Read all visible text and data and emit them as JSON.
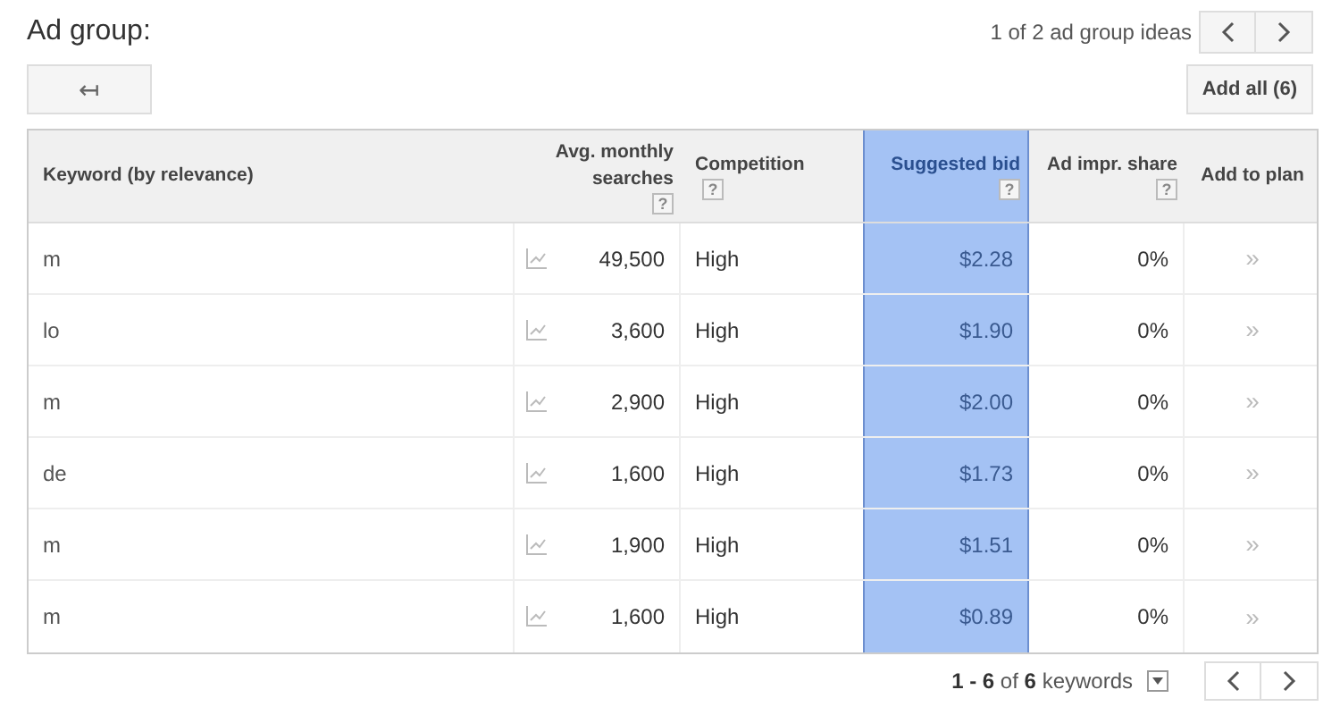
{
  "title": "Ad group:",
  "pager": {
    "text": "1 of 2 ad group ideas"
  },
  "back_button": "↤",
  "add_all_button": "Add all (6)",
  "columns": [
    {
      "label": "Keyword (by relevance)",
      "highlighted": false
    },
    {
      "label": "Avg. monthly searches",
      "help": "?",
      "highlighted": false
    },
    {
      "label": "Competition",
      "help": "?",
      "highlighted": false
    },
    {
      "label": "Suggested bid",
      "help": "?",
      "highlighted": true
    },
    {
      "label": "Ad impr. share",
      "help": "?",
      "highlighted": false
    },
    {
      "label": "Add to plan",
      "highlighted": false
    }
  ],
  "rows": [
    {
      "keyword": "m",
      "searches": "49,500",
      "competition": "High",
      "bid": "$2.28",
      "share": "0%"
    },
    {
      "keyword": "lo",
      "searches": "3,600",
      "competition": "High",
      "bid": "$1.90",
      "share": "0%"
    },
    {
      "keyword": "m",
      "searches": "2,900",
      "competition": "High",
      "bid": "$2.00",
      "share": "0%"
    },
    {
      "keyword": "de",
      "searches": "1,600",
      "competition": "High",
      "bid": "$1.73",
      "share": "0%"
    },
    {
      "keyword": "m",
      "searches": "1,900",
      "competition": "High",
      "bid": "$1.51",
      "share": "0%"
    },
    {
      "keyword": "m",
      "searches": "1,600",
      "competition": "High",
      "bid": "$0.89",
      "share": "0%"
    }
  ],
  "add_icon": "»",
  "footer": {
    "range": "1 - 6",
    "of": "of",
    "total": "6",
    "unit": "keywords"
  }
}
